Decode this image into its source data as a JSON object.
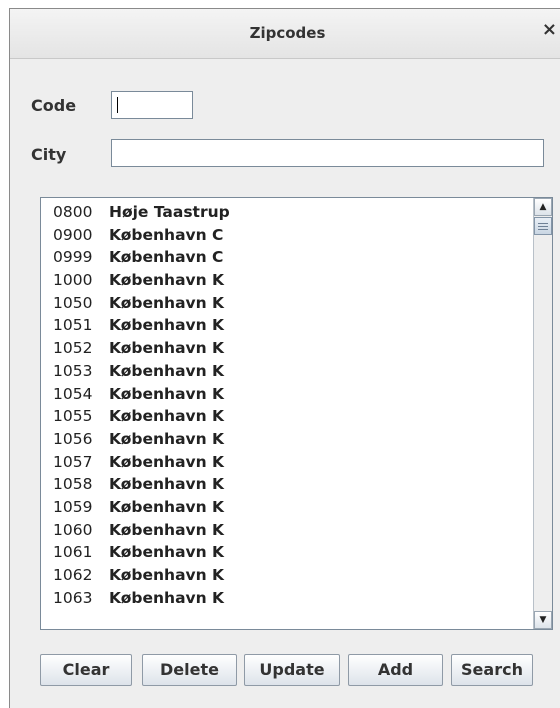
{
  "window": {
    "title": "Zipcodes",
    "close_glyph": "×"
  },
  "form": {
    "code_label": "Code",
    "code_value": "",
    "city_label": "City",
    "city_value": ""
  },
  "list": {
    "items": [
      {
        "zip": "0800",
        "city": "Høje Taastrup"
      },
      {
        "zip": "0900",
        "city": "København C"
      },
      {
        "zip": "0999",
        "city": "København C"
      },
      {
        "zip": "1000",
        "city": "København K"
      },
      {
        "zip": "1050",
        "city": "København K"
      },
      {
        "zip": "1051",
        "city": "København K"
      },
      {
        "zip": "1052",
        "city": "København K"
      },
      {
        "zip": "1053",
        "city": "København K"
      },
      {
        "zip": "1054",
        "city": "København K"
      },
      {
        "zip": "1055",
        "city": "København K"
      },
      {
        "zip": "1056",
        "city": "København K"
      },
      {
        "zip": "1057",
        "city": "København K"
      },
      {
        "zip": "1058",
        "city": "København K"
      },
      {
        "zip": "1059",
        "city": "København K"
      },
      {
        "zip": "1060",
        "city": "København K"
      },
      {
        "zip": "1061",
        "city": "København K"
      },
      {
        "zip": "1062",
        "city": "København K"
      },
      {
        "zip": "1063",
        "city": "København K"
      }
    ],
    "scroll_up_glyph": "▲",
    "scroll_down_glyph": "▼"
  },
  "buttons": {
    "clear": "Clear",
    "delete": "Delete",
    "update": "Update",
    "add": "Add",
    "search": "Search"
  }
}
